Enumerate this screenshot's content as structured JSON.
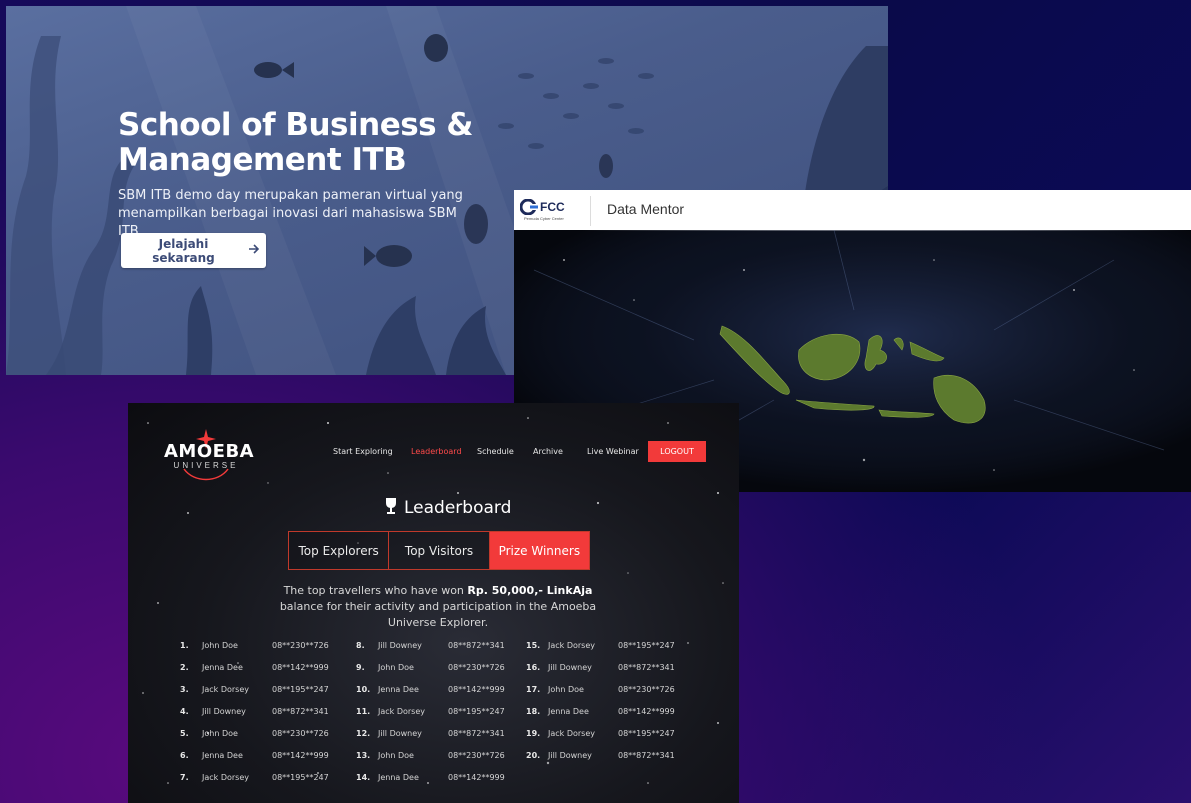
{
  "sbm": {
    "title_line1": "School of Business &",
    "title_line2": "Management ITB",
    "desc_line1": "SBM ITB demo day merupakan pameran virtual yang",
    "desc_line2": "menampilkan berbagai inovasi dari mahasiswa SBM ITB.",
    "cta_label": "Jelajahi sekarang",
    "cta_icon": "arrow-right-icon",
    "colors": {
      "bg": "#4a5d8c",
      "button_text": "#3c4b77"
    }
  },
  "fcc": {
    "logo_text": "FCC",
    "logo_subtext": "Pemuda Cyber Center",
    "page_title": "Data Mentor",
    "scene": "indonesia-map-in-space"
  },
  "amoeba": {
    "logo_text": "AMOEBA",
    "logo_subtext": "UNIVERSE",
    "nav": [
      {
        "label": "Start Exploring",
        "active": false
      },
      {
        "label": "Leaderboard",
        "active": true
      },
      {
        "label": "Schedule",
        "active": false
      },
      {
        "label": "Archive",
        "active": false
      },
      {
        "label": "Live Webinar",
        "active": false
      }
    ],
    "logout_label": "LOGOUT",
    "heading": "Leaderboard",
    "heading_icon": "trophy-icon",
    "tabs": [
      {
        "label": "Top Explorers",
        "active": false
      },
      {
        "label": "Top Visitors",
        "active": false
      },
      {
        "label": "Prize Winners",
        "active": true
      }
    ],
    "desc_pre": "The top travellers who have won ",
    "desc_bold": "Rp. 50,000,- LinkAja",
    "desc_post": " balance for their activity and participation in the Amoeba Universe Explorer.",
    "winners": [
      {
        "rank": "1.",
        "name": "John Doe",
        "phone": "08**230**726"
      },
      {
        "rank": "2.",
        "name": "Jenna Dee",
        "phone": "08**142**999"
      },
      {
        "rank": "3.",
        "name": "Jack Dorsey",
        "phone": "08**195**247"
      },
      {
        "rank": "4.",
        "name": "Jill Downey",
        "phone": "08**872**341"
      },
      {
        "rank": "5.",
        "name": "John Doe",
        "phone": "08**230**726"
      },
      {
        "rank": "6.",
        "name": "Jenna Dee",
        "phone": "08**142**999"
      },
      {
        "rank": "7.",
        "name": "Jack Dorsey",
        "phone": "08**195**247"
      },
      {
        "rank": "8.",
        "name": "Jill Downey",
        "phone": "08**872**341"
      },
      {
        "rank": "9.",
        "name": "John Doe",
        "phone": "08**230**726"
      },
      {
        "rank": "10.",
        "name": "Jenna Dee",
        "phone": "08**142**999"
      },
      {
        "rank": "11.",
        "name": "Jack Dorsey",
        "phone": "08**195**247"
      },
      {
        "rank": "12.",
        "name": "Jill Downey",
        "phone": "08**872**341"
      },
      {
        "rank": "13.",
        "name": "John Doe",
        "phone": "08**230**726"
      },
      {
        "rank": "14.",
        "name": "Jenna Dee",
        "phone": "08**142**999"
      },
      {
        "rank": "15.",
        "name": "Jack Dorsey",
        "phone": "08**195**247"
      },
      {
        "rank": "16.",
        "name": "Jill Downey",
        "phone": "08**872**341"
      },
      {
        "rank": "17.",
        "name": "John Doe",
        "phone": "08**230**726"
      },
      {
        "rank": "18.",
        "name": "Jenna Dee",
        "phone": "08**142**999"
      },
      {
        "rank": "19.",
        "name": "Jack Dorsey",
        "phone": "08**195**247"
      },
      {
        "rank": "20.",
        "name": "Jill Downey",
        "phone": "08**872**341"
      }
    ],
    "colors": {
      "accent": "#f23a3a",
      "active_nav": "#ff4a4a"
    }
  }
}
